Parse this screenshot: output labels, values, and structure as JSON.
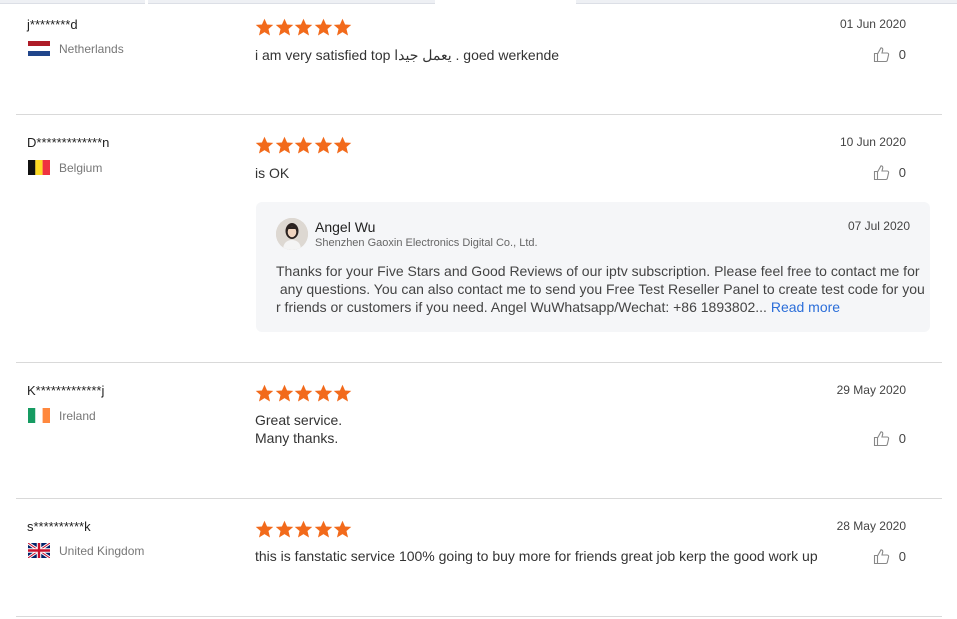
{
  "reviews": [
    {
      "user": "j********d",
      "country": "Netherlands",
      "rating": 5,
      "text": "i am very satisfied top يعمل جيدا . goed werkende",
      "date": "01 Jun 2020",
      "likes": "0"
    },
    {
      "user": "D*************n",
      "country": "Belgium",
      "rating": 5,
      "text": "is OK",
      "date": "10 Jun 2020",
      "likes": "0",
      "reply": {
        "name": "Angel Wu",
        "company": "Shenzhen Gaoxin Electronics Digital Co., Ltd.",
        "date": "07 Jul 2020",
        "lines": [
          "Thanks for your Five Stars and Good Reviews of our iptv subscription. Please feel free to contact me for",
          " any questions. You can also contact me to send you Free Test Reseller Panel to create test code for you",
          "r friends or customers if you need. Angel WuWhatsapp/Wechat: +86 1893802..."
        ],
        "read_more": "Read more"
      }
    },
    {
      "user": "K*************j",
      "country": "Ireland",
      "rating": 5,
      "text_lines": [
        "Great service.",
        "Many thanks."
      ],
      "date": "29 May 2020",
      "likes": "0"
    },
    {
      "user": "s**********k",
      "country": "United Kingdom",
      "rating": 5,
      "text": "this is fanstatic service 100% going to buy more for friends great job kerp the good work up",
      "date": "28 May 2020",
      "likes": "0"
    }
  ],
  "colors": {
    "star": "#f26a1b",
    "link": "#2b6ed9",
    "divider": "#d9d9d9"
  },
  "icons": {
    "star": "star-icon",
    "like": "thumbs-up-icon"
  }
}
